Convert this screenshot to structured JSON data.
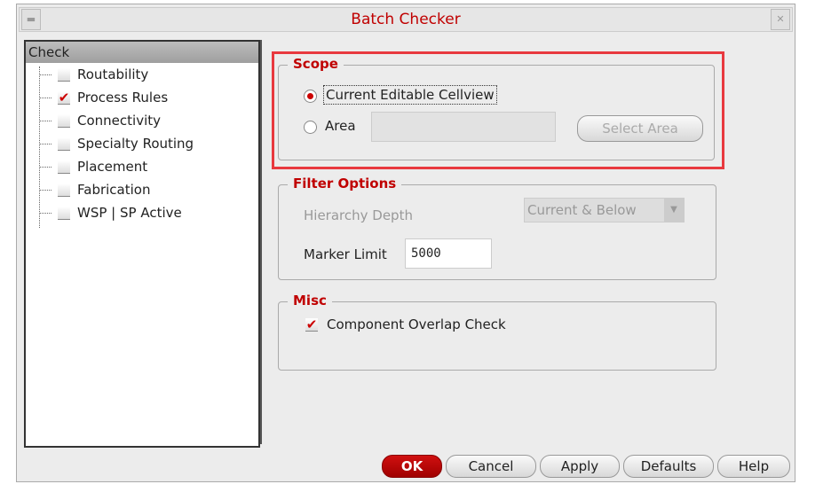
{
  "window": {
    "title": "Batch Checker"
  },
  "tree": {
    "header": "Check",
    "items": [
      {
        "label": "Routability",
        "checked": false
      },
      {
        "label": "Process Rules",
        "checked": true
      },
      {
        "label": "Connectivity",
        "checked": false
      },
      {
        "label": "Specialty Routing",
        "checked": false
      },
      {
        "label": "Placement",
        "checked": false
      },
      {
        "label": "Fabrication",
        "checked": false
      },
      {
        "label": "WSP | SP Active",
        "checked": false
      }
    ]
  },
  "scope": {
    "title": "Scope",
    "option1": "Current Editable Cellview",
    "option2": "Area",
    "area_value": "",
    "select_area": "Select Area"
  },
  "filter": {
    "title": "Filter Options",
    "hierarchy_label": "Hierarchy Depth",
    "hierarchy_value": "Current & Below",
    "marker_label": "Marker Limit",
    "marker_value": "5000"
  },
  "misc": {
    "title": "Misc",
    "overlap_label": "Component Overlap Check",
    "overlap_checked": true
  },
  "buttons": {
    "ok": "OK",
    "cancel": "Cancel",
    "apply": "Apply",
    "defaults": "Defaults",
    "help": "Help"
  },
  "colors": {
    "accent": "#c00000",
    "highlight": "#e8393f"
  }
}
